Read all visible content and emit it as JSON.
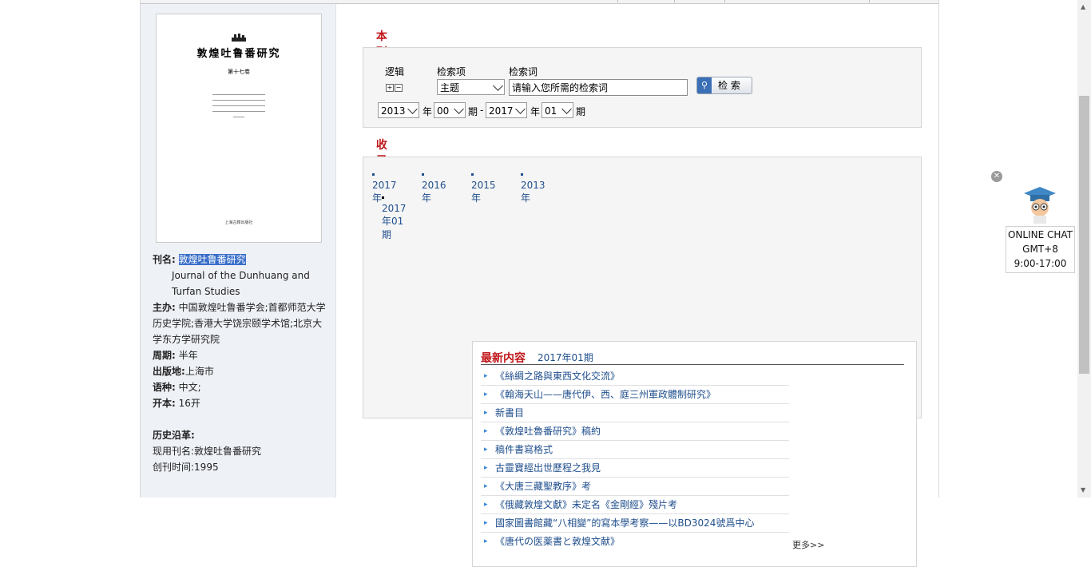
{
  "cover": {
    "title": "敦煌吐鲁番研究",
    "volume": "第十七卷",
    "publisher": "上海古籍出版社"
  },
  "journal_info": {
    "name_label": "刊名:",
    "name_value": "敦煌吐鲁番研究",
    "english_name": "Journal of the Dunhuang and Turfan Studies",
    "sponsor_label": "主办:",
    "sponsor_value": "中国敦煌吐鲁番学会;首都师范大学历史学院;香港大学饶宗颐学术馆;北京大学东方学研究院",
    "period_label": "周期:",
    "period_value": "半年",
    "place_label": "出版地:",
    "place_value": "上海市",
    "lang_label": "语种:",
    "lang_value": "中文;",
    "format_label": "开本:",
    "format_value": "16开",
    "history_label": "历史沿革:",
    "current_name": "现用刊名:敦煌吐鲁番研究",
    "founded": "创刊时间:1995"
  },
  "search": {
    "section_title": "本刊检索",
    "logic_label": "逻辑",
    "field_label": "检索项",
    "term_label": "检索词",
    "field_value": "主题",
    "term_placeholder": "请输入您所需的检索词",
    "button_label": "检 索",
    "from_year": "2013",
    "from_issue": "00",
    "to_year": "2017",
    "to_issue": "01",
    "year_char": "年",
    "issue_char": "期",
    "dash": "-"
  },
  "issues": {
    "section_title": "收录刊期",
    "years": [
      "2017年",
      "2016年",
      "2015年",
      "2013年"
    ],
    "selected_issue": "2017年01期"
  },
  "latest": {
    "heading": "最新内容",
    "issue": "2017年01期",
    "items": [
      "《絲綢之路與東西文化交流》",
      "《翰海天山——唐代伊、西、庭三州軍政體制研究》",
      "新書目",
      "《敦煌吐魯番研究》稿約",
      "稿件書寫格式",
      "古靈寶經出世歷程之我見",
      "《大唐三藏聖教序》考",
      "《俄藏敦煌文獻》未定名《金剛經》殘片考",
      "國家圖書館藏“八相變”的寫本學考察——以BD3024號爲中心",
      "《唐代の医薬書と敦煌文献》"
    ],
    "more": "更多>>"
  },
  "chat": {
    "line1": "ONLINE CHAT",
    "line2": "GMT+8",
    "line3": "9:00-17:00"
  }
}
